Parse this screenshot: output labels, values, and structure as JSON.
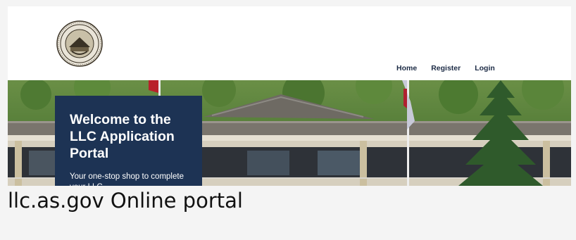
{
  "nav": {
    "home": "Home",
    "register": "Register",
    "login": "Login"
  },
  "hero": {
    "title": "Welcome to the LLC Application Portal",
    "subtitle": "Your one-stop shop to complete your LLC"
  },
  "caption": "llc.as.gov Online portal",
  "colors": {
    "navy": "#1d3354",
    "nav_text": "#1c2b45"
  }
}
